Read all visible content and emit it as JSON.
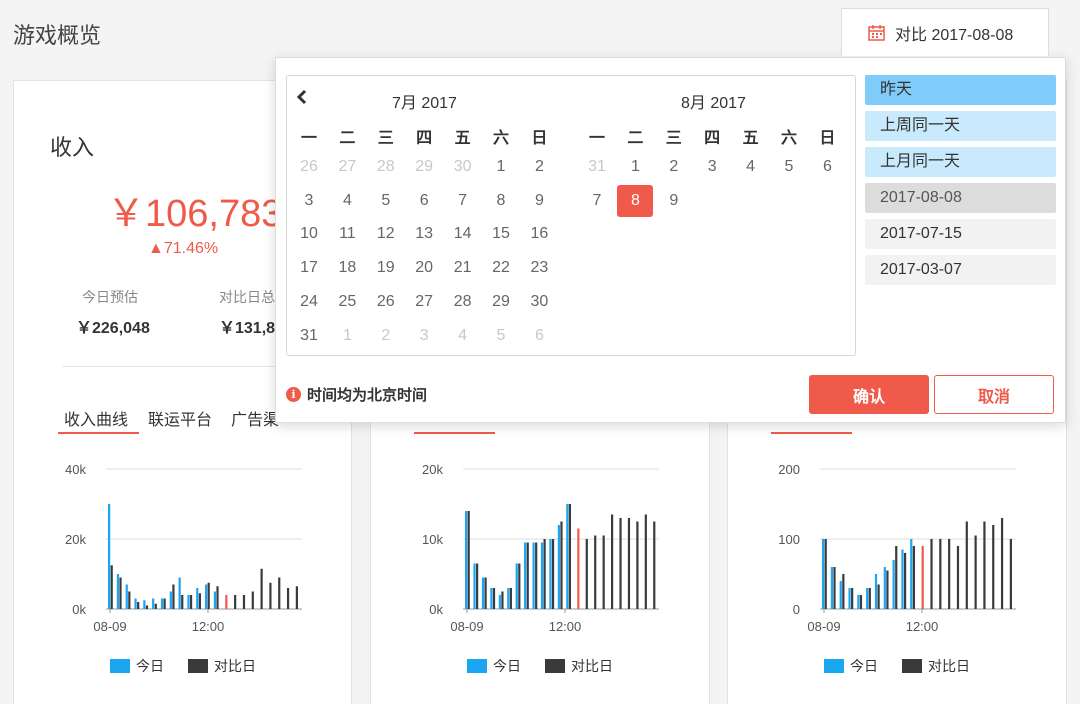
{
  "page": {
    "title": "游戏概览"
  },
  "compare_button": {
    "label": "对比 2017-08-08"
  },
  "revenue_card": {
    "title": "收入",
    "value": "￥106,783",
    "change": "▲71.46%",
    "stats": [
      {
        "label": "今日预估",
        "value": "￥226,048"
      },
      {
        "label": "对比日总",
        "value": "￥131,8"
      }
    ],
    "tabs": [
      "收入曲线",
      "联运平台",
      "广告渠"
    ]
  },
  "legend": {
    "today": "今日",
    "compare": "对比日"
  },
  "colors": {
    "accent": "#f05a4a",
    "today": "#1aa6f0",
    "compare": "#3a3a3a"
  },
  "date_picker": {
    "left_month": "7月 2017",
    "right_month": "8月 2017",
    "weekdays": [
      "一",
      "二",
      "三",
      "四",
      "五",
      "六",
      "日"
    ],
    "left_days": [
      [
        26,
        27,
        28,
        29,
        30,
        1,
        2
      ],
      [
        3,
        4,
        5,
        6,
        7,
        8,
        9
      ],
      [
        10,
        11,
        12,
        13,
        14,
        15,
        16
      ],
      [
        17,
        18,
        19,
        20,
        21,
        22,
        23
      ],
      [
        24,
        25,
        26,
        27,
        28,
        29,
        30
      ],
      [
        31,
        1,
        2,
        3,
        4,
        5,
        6
      ]
    ],
    "right_days": [
      [
        31,
        1,
        2,
        3,
        4,
        5,
        6
      ],
      [
        7,
        8,
        9
      ]
    ],
    "selected": "8",
    "presets": [
      "昨天",
      "上周同一天",
      "上月同一天",
      "2017-08-08",
      "2017-07-15",
      "2017-03-07"
    ],
    "note": "时间均为北京时间",
    "confirm": "确认",
    "cancel": "取消"
  },
  "chart_data": [
    {
      "type": "bar",
      "yticks": [
        "40k",
        "20k",
        "0k"
      ],
      "xticks": [
        "08-09",
        "12:00"
      ],
      "ylim": [
        0,
        40000
      ],
      "series": [
        {
          "name": "今日",
          "values": [
            30000,
            10000,
            7000,
            3000,
            2500,
            3000,
            3000,
            5000,
            9000,
            4000,
            6000,
            7000,
            5000,
            null,
            null,
            null,
            null,
            null,
            null,
            null,
            null,
            null
          ]
        },
        {
          "name": "对比日",
          "values": [
            12500,
            9000,
            5000,
            2000,
            1000,
            1500,
            3000,
            7000,
            4000,
            4000,
            4500,
            7500,
            6500,
            4000,
            4000,
            4000,
            5000,
            11500,
            7500,
            9000,
            6000,
            6500
          ]
        }
      ]
    },
    {
      "type": "bar",
      "yticks": [
        "20k",
        "10k",
        "0k"
      ],
      "xticks": [
        "08-09",
        "12:00"
      ],
      "ylim": [
        0,
        20000
      ],
      "series": [
        {
          "name": "今日",
          "values": [
            14000,
            6500,
            4500,
            3000,
            2000,
            3000,
            6500,
            9500,
            9500,
            9500,
            10000,
            12000,
            15000,
            null,
            null,
            null,
            null,
            null,
            null,
            null,
            null,
            null
          ]
        },
        {
          "name": "对比日",
          "values": [
            14000,
            6500,
            4500,
            3000,
            2500,
            3000,
            6500,
            9500,
            9500,
            10000,
            10000,
            12500,
            15000,
            11500,
            10000,
            10500,
            10500,
            13500,
            13000,
            13000,
            12500,
            13500,
            12500
          ]
        }
      ]
    },
    {
      "type": "bar",
      "yticks": [
        "200",
        "100",
        "0"
      ],
      "xticks": [
        "08-09",
        "12:00"
      ],
      "ylim": [
        0,
        200
      ],
      "series": [
        {
          "name": "今日",
          "values": [
            100,
            60,
            40,
            30,
            20,
            30,
            50,
            60,
            70,
            85,
            100,
            null,
            null,
            null,
            null,
            null,
            null,
            null,
            null,
            null,
            null,
            null
          ]
        },
        {
          "name": "对比日",
          "values": [
            100,
            60,
            50,
            30,
            20,
            30,
            35,
            55,
            90,
            80,
            90,
            90,
            100,
            100,
            100,
            90,
            125,
            105,
            125,
            120,
            130,
            100
          ]
        }
      ]
    }
  ]
}
